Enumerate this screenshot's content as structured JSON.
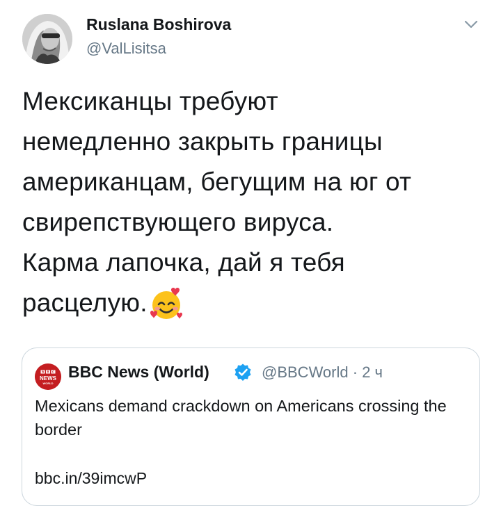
{
  "author": {
    "name": "Ruslana Boshirova",
    "handle": "@ValLisitsa"
  },
  "tweet": {
    "lines": [
      "Мексиканцы требуют",
      "немедленно закрыть границы",
      "американцам, бегущим на юг от",
      "свирепствующего вируса.",
      "Карма лапочка, дай я тебя",
      "расцелую."
    ],
    "emoji": "smiling-face-with-hearts-icon"
  },
  "quote": {
    "logo_text": [
      "BBC",
      "NEWS",
      "WORLD"
    ],
    "name": "BBC News (World)",
    "handle": "@BBCWorld",
    "separator": "·",
    "time": "2 ч",
    "headline": "Mexicans demand crackdown on Americans crossing the border",
    "link": "bbc.in/39imcwP"
  },
  "colors": {
    "text": "#14171a",
    "secondary": "#657786",
    "border": "#ccd6dd",
    "verified": "#1da1f2",
    "bbc_red": "#c41e21"
  }
}
